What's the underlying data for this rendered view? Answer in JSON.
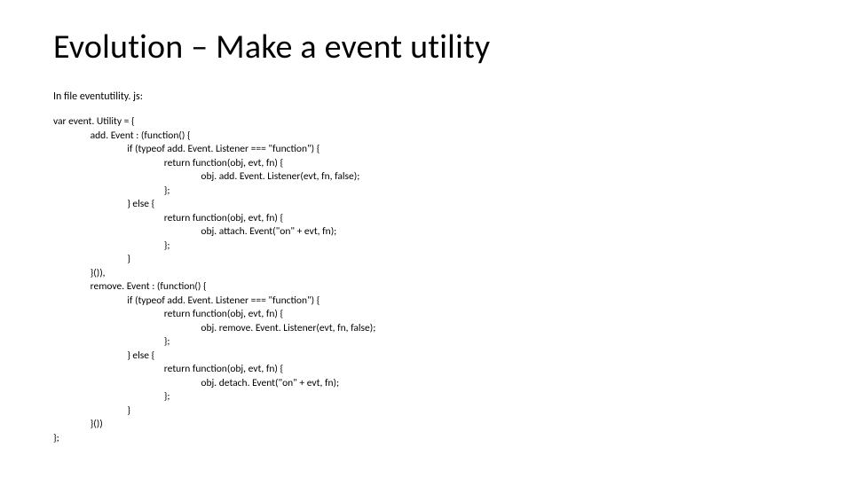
{
  "title": "Evolution – Make a event utility",
  "intro": "In file eventutility. js:",
  "code": {
    "l01": "var event. Utility = {",
    "l02": "\t\tadd. Event : (function() {",
    "l03": "\t\t\t\tif (typeof add. Event. Listener === \"function\") {",
    "l04": "\t\t\t\t\t\treturn function(obj, evt, fn) {",
    "l05": "\t\t\t\t\t\t\t\tobj. add. Event. Listener(evt, fn, false);",
    "l06": "\t\t\t\t\t\t};",
    "l07": "\t\t\t\t} else {",
    "l08": "\t\t\t\t\t\treturn function(obj, evt, fn) {",
    "l09": "\t\t\t\t\t\t\t\tobj. attach. Event(\"on\" + evt, fn);",
    "l10": "\t\t\t\t\t\t};",
    "l11": "\t\t\t\t}",
    "l12": "\t\t}()),",
    "l13": "\t\tremove. Event : (function() {",
    "l14": "\t\t\t\tif (typeof add. Event. Listener === \"function\") {",
    "l15": "\t\t\t\t\t\treturn function(obj, evt, fn) {",
    "l16": "\t\t\t\t\t\t\t\tobj. remove. Event. Listener(evt, fn, false);",
    "l17": "\t\t\t\t\t\t};",
    "l18": "\t\t\t\t} else {",
    "l19": "\t\t\t\t\t\treturn function(obj, evt, fn) {",
    "l20": "\t\t\t\t\t\t\t\tobj. detach. Event(\"on\" + evt, fn);",
    "l21": "\t\t\t\t\t\t};",
    "l22": "\t\t\t\t}",
    "l23": "\t\t}())",
    "l24": "};"
  }
}
